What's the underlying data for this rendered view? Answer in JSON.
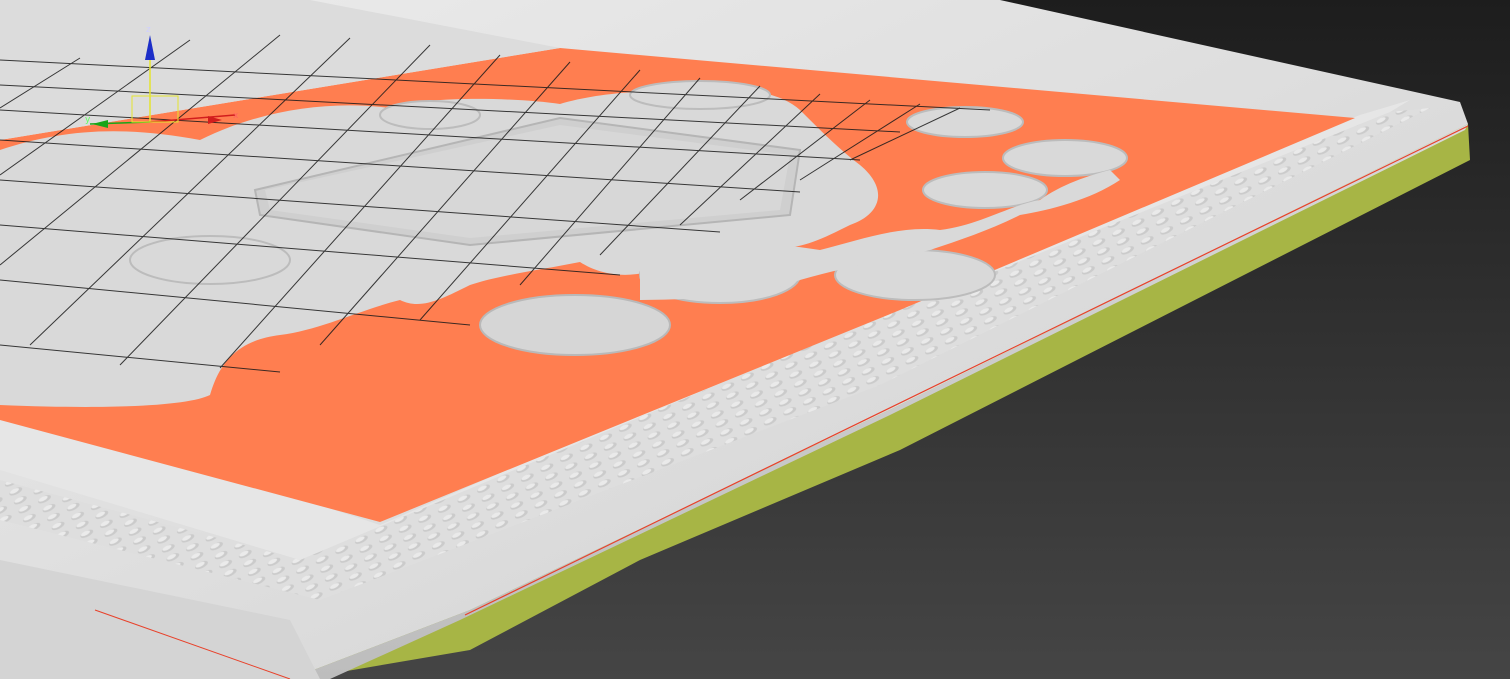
{
  "viewport": {
    "background_top": "#1d1d1d",
    "background_bottom": "#454545"
  },
  "model": {
    "frame_color": "#e2e2e2",
    "inner_panel_color": "#ff7e50",
    "relief_color": "#d9d9d9",
    "base_slab_color": "#a7b545",
    "edge_highlight_color": "#e8412a"
  },
  "grid": {
    "visible": true,
    "color": "#1a1a1a"
  },
  "gizmo": {
    "x_axis_label": "x",
    "y_axis_label": "y",
    "z_axis_label": "z",
    "x_color": "#d21d1d",
    "y_color": "#18a518",
    "z_color": "#1c2ec8",
    "plane_color": "#e5e52f"
  }
}
